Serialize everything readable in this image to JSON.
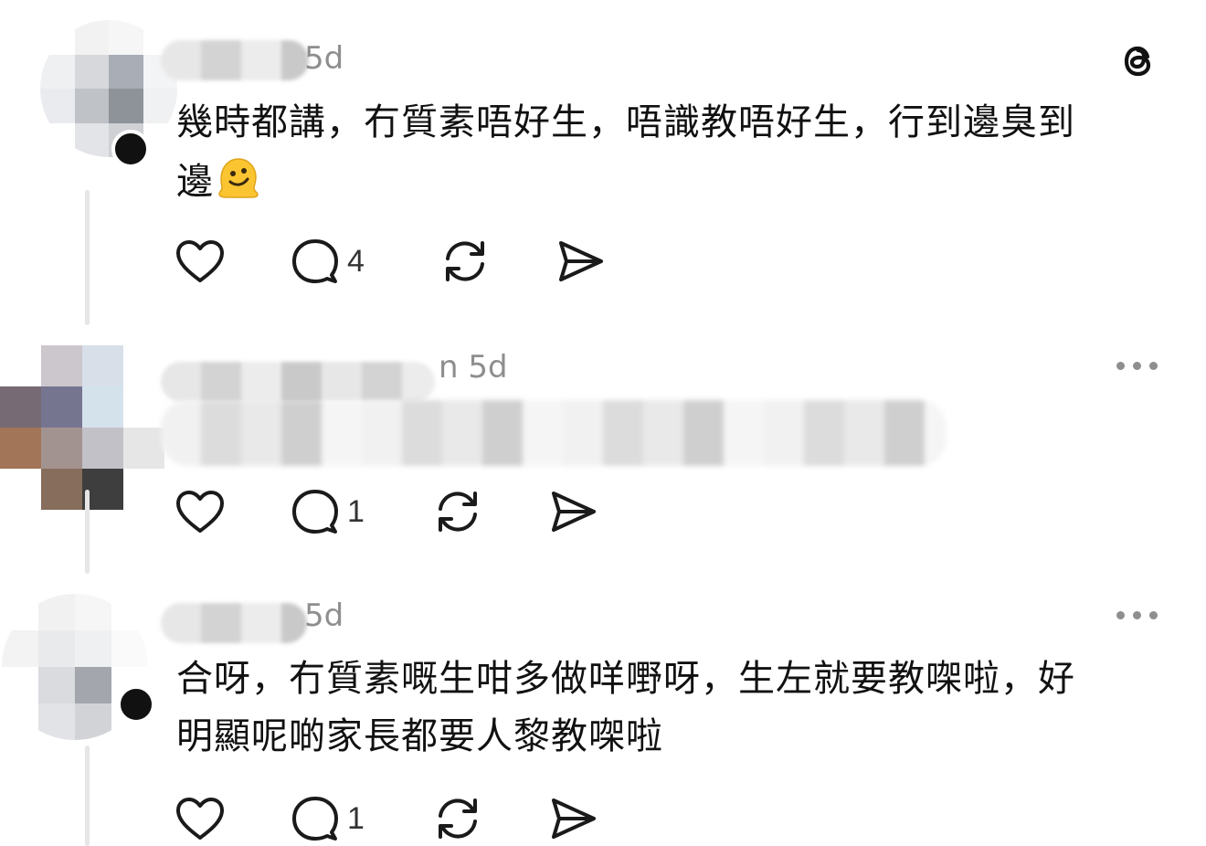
{
  "posts": [
    {
      "time": "5d",
      "text_line1": "幾時都講，冇質素唔好生，唔識教唔好生，行到邊臭到",
      "text_line2": "邊",
      "emoji": "melting-face",
      "reply_count": "4",
      "top_right_icon": "threads-logo"
    },
    {
      "time_prefix": "n",
      "time": "5d",
      "reply_count": "1"
    },
    {
      "time": "5d",
      "text_line1": "合呀，冇質素嘅生咁多做咩嘢呀，生左就要教㗎啦，好",
      "text_line2": "明顯呢啲家長都要人黎教㗎啦",
      "reply_count": "1"
    }
  ],
  "colors": {
    "text": "#111111",
    "muted": "#8e8e8e",
    "icon": "#1a1a1a"
  }
}
